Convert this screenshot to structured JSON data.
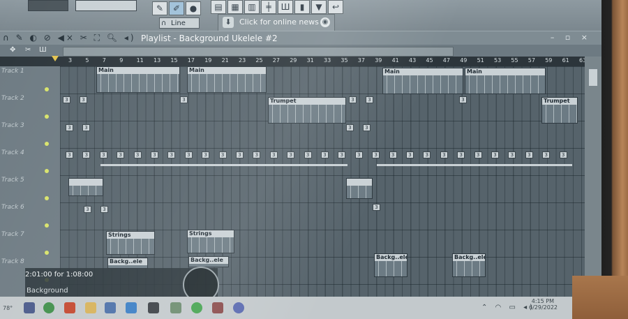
{
  "toolbar": {
    "snap_mode": "Line",
    "news_text": "Click for online news"
  },
  "playlist": {
    "title": "Playlist - Background Ukelele #2",
    "ruler_ticks": [
      "3",
      "5",
      "7",
      "9",
      "11",
      "13",
      "15",
      "17",
      "19",
      "21",
      "23",
      "25",
      "27",
      "29",
      "31",
      "33",
      "35",
      "37",
      "39",
      "41",
      "43",
      "45",
      "47",
      "49",
      "51",
      "53",
      "55",
      "57",
      "59",
      "61",
      "63"
    ],
    "tracks": [
      "Track 1",
      "Track 2",
      "Track 3",
      "Track 4",
      "Track 5",
      "Track 6",
      "Track 7",
      "Track 8"
    ],
    "clips": {
      "main": "Main",
      "trumpet": "Trumpet",
      "strings": "Strings",
      "backg": "Backg..ele"
    }
  },
  "hint": {
    "time": "2:01:00 for 1:08:00",
    "name": "Background"
  },
  "taskbar": {
    "weather": "78°",
    "time": "4:15 PM",
    "date": "6/29/2022"
  },
  "colors": {
    "accent": "#e3c450",
    "clip_header": "#c9d1d5",
    "grid_bg": "#56636b"
  }
}
